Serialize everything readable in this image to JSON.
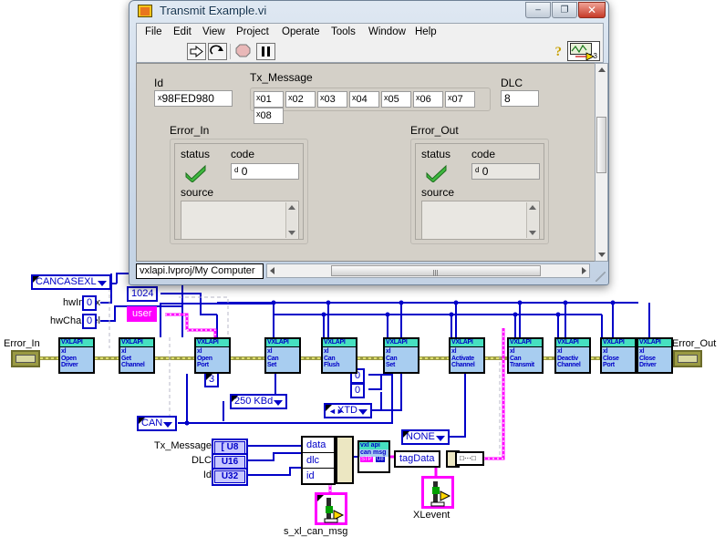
{
  "window": {
    "title": "Transmit Example.vi",
    "icon_name": "labview-vi-icon",
    "buttons": {
      "minimize": "–",
      "maximize": "❐",
      "close": "✕"
    }
  },
  "menubar": {
    "items": [
      {
        "label": "File"
      },
      {
        "label": "Edit"
      },
      {
        "label": "View"
      },
      {
        "label": "Project"
      },
      {
        "label": "Operate"
      },
      {
        "label": "Tools"
      },
      {
        "label": "Window"
      },
      {
        "label": "Help"
      }
    ]
  },
  "toolbar": {
    "buttons": [
      {
        "name": "run-button",
        "glyph": "⇨"
      },
      {
        "name": "run-continuously-button",
        "glyph": "⟳"
      },
      {
        "name": "abort-button",
        "glyph": "⬤"
      },
      {
        "name": "pause-button",
        "glyph": "❚❚"
      }
    ],
    "help_glyph": "?",
    "vi_badge_number": "3"
  },
  "front_panel": {
    "id": {
      "label": "Id",
      "prefix": "x",
      "value": "98FED980"
    },
    "tx_message": {
      "label": "Tx_Message",
      "prefix": "x",
      "cells": [
        "01",
        "02",
        "03",
        "04",
        "05",
        "06",
        "07",
        "08"
      ]
    },
    "dlc": {
      "label": "DLC",
      "value": "8"
    },
    "error_in": {
      "label": "Error_In",
      "status_label": "status",
      "status_ok": true,
      "code_label": "code",
      "code_prefix": "d",
      "code_value": "0",
      "source_label": "source",
      "source_value": ""
    },
    "error_out": {
      "label": "Error_Out",
      "status_label": "status",
      "status_ok": true,
      "code_label": "code",
      "code_prefix": "d",
      "code_value": "0",
      "source_label": "source",
      "source_value": ""
    }
  },
  "statusbar": {
    "text": "vxlapi.lvproj/My Computer"
  },
  "diagram": {
    "labels": {
      "hw_index": "hwIndex",
      "hw_channel": "hwChannel",
      "error_in": "Error_In",
      "error_out": "Error_Out",
      "tx_message": "Tx_Message",
      "dlc": "DLC",
      "id": "Id",
      "s_xl_can_msg": "s_xl_can_msg",
      "xlevent": "XLevent"
    },
    "constants": {
      "hw_type": "CANCASEXL",
      "hw_index_value": "0",
      "hw_channel_value": "0",
      "rx_queue_size": "1024",
      "user_name": "user",
      "port_handle_num": "3",
      "baudrate": "250 KBd",
      "bus_type": "CAN",
      "flags_zero_a": "0",
      "flags_zero_b": "0",
      "msg_flag": "XTD",
      "access_mask": "NONE"
    },
    "terminals": {
      "tx_message_type": "[ U8",
      "dlc_type": "U16",
      "id_type": "U32"
    },
    "bundle": {
      "fields": [
        "data",
        "dlc",
        "id"
      ]
    },
    "tag_data": "tagData",
    "converter": {
      "line1": "vxl api",
      "line2": "can msg",
      "line3a": "STP",
      "line3b": "U8"
    },
    "nodes": [
      {
        "header": "VXLAPI",
        "line1": "xl",
        "line2": "Open",
        "line3": "Driver"
      },
      {
        "header": "VXLAPI",
        "line1": "xl",
        "line2": "Get",
        "line3": "Channel"
      },
      {
        "header": "VXLAPI",
        "line1": "xl",
        "line2": "Open",
        "line3": "Port"
      },
      {
        "header": "VXLAPI",
        "line1": "xl",
        "line2": "Can",
        "line3": "Set"
      },
      {
        "header": "VXLAPI",
        "line1": "xl",
        "line2": "Can",
        "line3": "Flush"
      },
      {
        "header": "VXLAPI",
        "line1": "xl",
        "line2": "Can",
        "line3": "Set"
      },
      {
        "header": "VXLAPI",
        "line1": "xl",
        "line2": "Activate",
        "line3": "Channel"
      },
      {
        "header": "VXLAPI",
        "line1": "xl",
        "line2": "Can",
        "line3": "Transmit"
      },
      {
        "header": "VXLAPI",
        "line1": "xl",
        "line2": "Deactiv",
        "line3": "Channel"
      },
      {
        "header": "VXLAPI",
        "line1": "xl",
        "line2": "Close",
        "line3": "Port"
      },
      {
        "header": "VXLAPI",
        "line1": "xl",
        "line2": "Close",
        "line3": "Driver"
      }
    ]
  },
  "colors": {
    "wire_blue": "#0000c8",
    "wire_error": "#9a9a43",
    "wire_cluster": "#ff00ff",
    "vi_header": "#46e0c0",
    "vi_body": "#a8cdf0",
    "panel_gray": "#d4d0c8"
  }
}
